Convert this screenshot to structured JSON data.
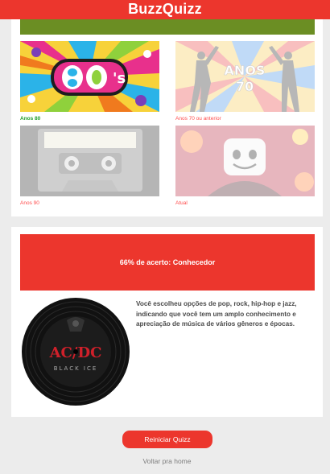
{
  "header": {
    "title": "BuzzQuizz"
  },
  "question": {
    "color": "#6b8e23"
  },
  "options": [
    {
      "caption": "Anos 80",
      "status": "correct",
      "image": "80s-retro-logo-image"
    },
    {
      "caption": "Anos 70 ou anterior",
      "status": "wrong",
      "image": "70s-disco-dancers-image"
    },
    {
      "caption": "Anos 90",
      "status": "wrong",
      "image": "90s-cassette-tape-image"
    },
    {
      "caption": "Atual",
      "status": "wrong",
      "image": "marshmello-dj-image"
    }
  ],
  "result": {
    "title": "66% de acerto: Conhecedor",
    "description": "Você escolheu opções de pop, rock, hip-hop e jazz, indicando que você tem um amplo conhecimento e apreciação de música de vários gêneros e épocas.",
    "image": "acdc-vinyl-record-image",
    "record_text": "AC/DC",
    "record_subtext": "BLACK ICE"
  },
  "actions": {
    "restart_label": "Reiniciar Quizz",
    "home_label": "Voltar pra home"
  },
  "colors": {
    "accent": "#ec362d",
    "correct": "#1f9d2a",
    "wrong": "#ff4b4b"
  }
}
